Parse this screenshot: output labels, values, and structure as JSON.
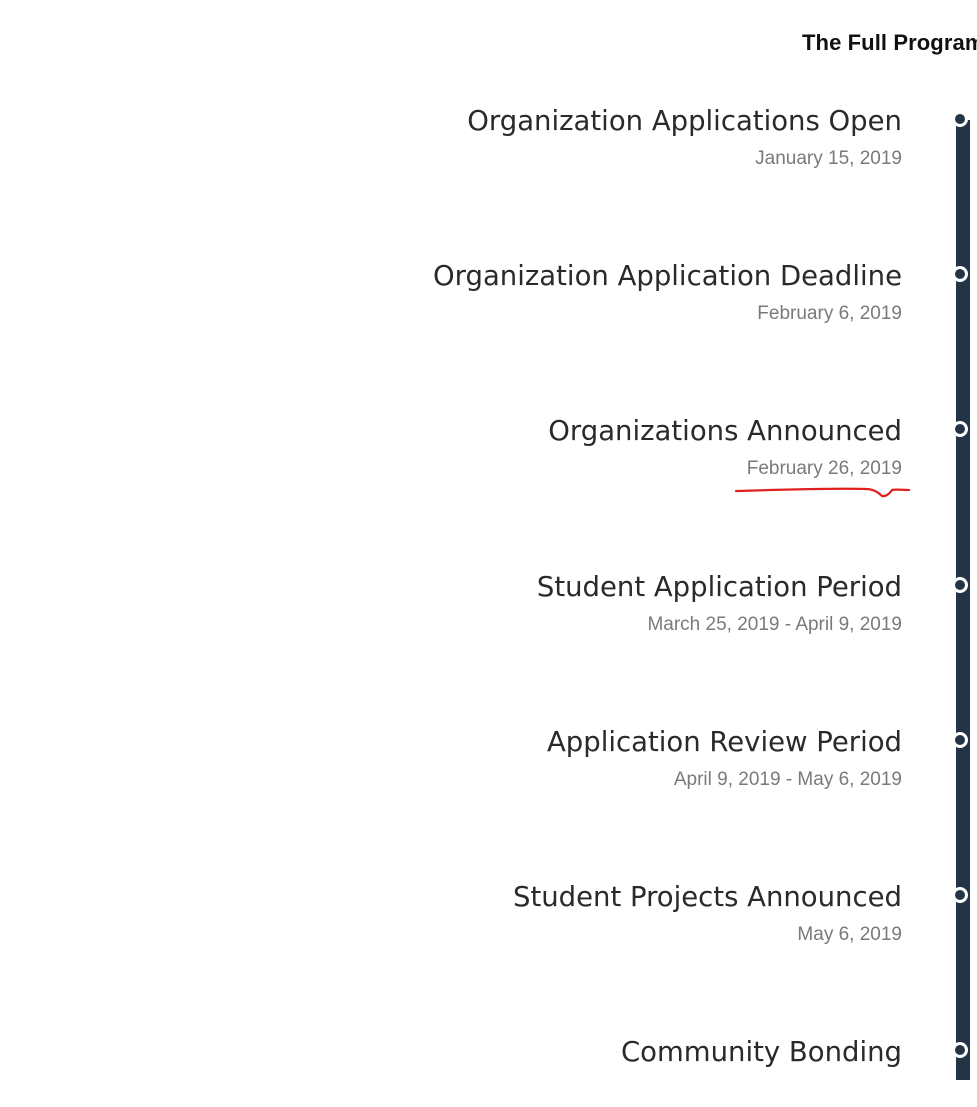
{
  "heading": "The Full Program",
  "timeline": {
    "accent_color": "#243447",
    "events": [
      {
        "title": "Organization Applications Open",
        "date": "January 15, 2019"
      },
      {
        "title": "Organization Application Deadline",
        "date": "February 6, 2019"
      },
      {
        "title": "Organizations Announced",
        "date": "February 26, 2019"
      },
      {
        "title": "Student Application Period",
        "date": "March 25, 2019 - April 9, 2019"
      },
      {
        "title": "Application Review Period",
        "date": "April 9, 2019 - May 6, 2019"
      },
      {
        "title": "Student Projects Announced",
        "date": "May 6, 2019"
      },
      {
        "title": "Community Bonding",
        "date": ""
      }
    ]
  },
  "annotation": {
    "color": "#e02020",
    "target": "February 26, 2019"
  }
}
